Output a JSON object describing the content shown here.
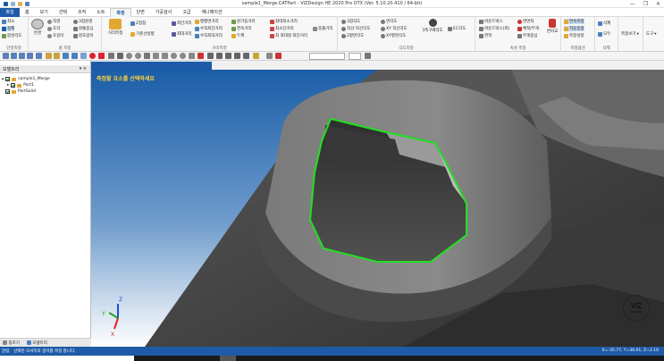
{
  "window": {
    "title": "sample1_Merge.CATPart - VIZDesign HE 2020 Pro DTX (Ver. 5.10.20.410 / 64-bit)",
    "minimize": "—",
    "restore": "❐",
    "close": "✕"
  },
  "menu": {
    "file": "파일",
    "items": [
      "홈",
      "보기",
      "선택",
      "조작",
      "노트",
      "측정",
      "단면",
      "가공검사",
      "고급",
      "애니메이션"
    ],
    "active_index": 5
  },
  "ribbon": {
    "unit_group": {
      "items": [
        "최소",
        "실제",
        "합성각도"
      ],
      "label": "단일측정"
    },
    "home_group": {
      "items": [
        "반경",
        "직경",
        "호각",
        "호길이",
        "3점원경",
        "원통중심",
        "원호길이",
        "원통반경"
      ],
      "label": "홈 측정"
    },
    "distance_group": {
      "items": [
        "거리측정",
        "2점점",
        "기준선방향",
        "최단거리",
        "최대거리",
        "평행면거리",
        "수직최단거리",
        "수직최대거리",
        "원기둥거리",
        "연속거리",
        "두께",
        "최대최소거리",
        "최소단거리",
        "최 최대형 최단거리",
        "중출거리"
      ],
      "label": "거리측정"
    },
    "angle_group": {
      "items": [
        "3점각도",
        "직선-직선각도",
        "2평면각도",
        "면각도",
        "XY 직선각도",
        "XY평면각도",
        "3축구배각도",
        "EC각도"
      ],
      "label": "각도측정"
    },
    "other_group": {
      "items": [
        "바운드박스",
        "바운드박스(좌)",
        "면적",
        "면면적",
        "체적/무게",
        "무게중심",
        "면비교"
      ],
      "label": "속성 측정"
    },
    "manage_group": {
      "items": [
        "연속측정",
        "자동중점",
        "측정설정"
      ],
      "label": "측정옵션"
    },
    "delete_group": {
      "items": [
        "삭제",
        "모두"
      ],
      "label": "삭제"
    },
    "view_group": {
      "items": [
        "측정보기"
      ],
      "label": ""
    },
    "tools_group": {
      "items": [
        "도구"
      ],
      "label": ""
    }
  },
  "toolbar": {
    "zoom_value": "",
    "combo_value": ""
  },
  "panel": {
    "title": "모델트리",
    "pin": "▾ ×",
    "tree": [
      {
        "label": "sample1_Merge",
        "indent": 0
      },
      {
        "label": "Part1",
        "indent": 1
      },
      {
        "label": "PartSolid",
        "indent": 0
      }
    ],
    "bottom_tabs": [
      "참조기",
      "모델트리"
    ]
  },
  "viewport": {
    "prompt": "측정할 요소를 선택하세요",
    "logo_top": "VIZ",
    "logo_bottom": "Design",
    "axes": {
      "x": "X",
      "y": "Y",
      "z": "Z"
    }
  },
  "status": {
    "left_label": "알림",
    "message": "선택된 모서리의 길이를 측정 합니다.",
    "coords": "X=-35.77, Y=36.01, Z=2.16"
  },
  "colors": {
    "accent": "#1e5aa8",
    "selection": "#22e022",
    "prompt": "#ffd23a"
  }
}
